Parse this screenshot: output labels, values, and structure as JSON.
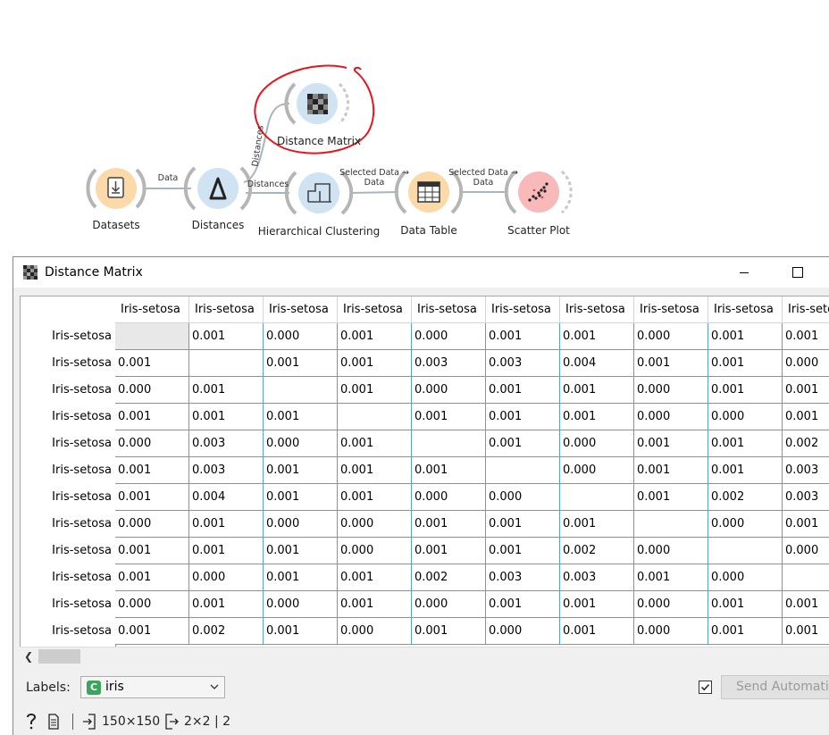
{
  "workflow": {
    "nodes": {
      "datasets": "Datasets",
      "distances": "Distances",
      "distance_matrix": "Distance Matrix",
      "hierarchical_clustering": "Hierarchical Clustering",
      "data_table": "Data Table",
      "scatter_plot": "Scatter Plot"
    },
    "links": {
      "datasets_to_distances": "Data",
      "distances_to_matrix": "Distances",
      "distances_to_clustering": "Distances",
      "clustering_to_table_top": "Selected Data →",
      "clustering_to_table_bottom": "Data",
      "table_to_scatter_top": "Selected Data →",
      "table_to_scatter_bottom": "Data"
    },
    "colors": {
      "orange_node": "#fcd9a8",
      "blue_node": "#cfe3f3",
      "red_node": "#f7b9b9",
      "annotation": "#e8141c"
    }
  },
  "window": {
    "title": "Distance Matrix",
    "title_icon": "distance-matrix-icon",
    "controls": [
      "minimize-icon",
      "maximize-icon"
    ]
  },
  "matrix": {
    "columns": [
      "Iris-setosa",
      "Iris-setosa",
      "Iris-setosa",
      "Iris-setosa",
      "Iris-setosa",
      "Iris-setosa",
      "Iris-setosa",
      "Iris-setosa",
      "Iris-setosa",
      "Iris-setosa"
    ],
    "rows": [
      {
        "label": "Iris-setosa",
        "cells": [
          "",
          "0.001",
          "0.000",
          "0.001",
          "0.000",
          "0.001",
          "0.001",
          "0.000",
          "0.001",
          "0.001"
        ]
      },
      {
        "label": "Iris-setosa",
        "cells": [
          "0.001",
          "",
          "0.001",
          "0.001",
          "0.003",
          "0.003",
          "0.004",
          "0.001",
          "0.001",
          "0.000"
        ]
      },
      {
        "label": "Iris-setosa",
        "cells": [
          "0.000",
          "0.001",
          "",
          "0.001",
          "0.000",
          "0.001",
          "0.001",
          "0.000",
          "0.001",
          "0.001"
        ]
      },
      {
        "label": "Iris-setosa",
        "cells": [
          "0.001",
          "0.001",
          "0.001",
          "",
          "0.001",
          "0.001",
          "0.001",
          "0.000",
          "0.000",
          "0.001"
        ]
      },
      {
        "label": "Iris-setosa",
        "cells": [
          "0.000",
          "0.003",
          "0.000",
          "0.001",
          "",
          "0.001",
          "0.000",
          "0.001",
          "0.001",
          "0.002"
        ]
      },
      {
        "label": "Iris-setosa",
        "cells": [
          "0.001",
          "0.003",
          "0.001",
          "0.001",
          "0.001",
          "",
          "0.000",
          "0.001",
          "0.001",
          "0.003"
        ]
      },
      {
        "label": "Iris-setosa",
        "cells": [
          "0.001",
          "0.004",
          "0.001",
          "0.001",
          "0.000",
          "0.000",
          "",
          "0.001",
          "0.002",
          "0.003"
        ]
      },
      {
        "label": "Iris-setosa",
        "cells": [
          "0.000",
          "0.001",
          "0.000",
          "0.000",
          "0.001",
          "0.001",
          "0.001",
          "",
          "0.000",
          "0.001"
        ]
      },
      {
        "label": "Iris-setosa",
        "cells": [
          "0.001",
          "0.001",
          "0.001",
          "0.000",
          "0.001",
          "0.001",
          "0.002",
          "0.000",
          "",
          "0.000"
        ]
      },
      {
        "label": "Iris-setosa",
        "cells": [
          "0.001",
          "0.000",
          "0.001",
          "0.001",
          "0.002",
          "0.003",
          "0.003",
          "0.001",
          "0.000",
          ""
        ]
      },
      {
        "label": "Iris-setosa",
        "cells": [
          "0.000",
          "0.001",
          "0.000",
          "0.001",
          "0.000",
          "0.001",
          "0.001",
          "0.000",
          "0.001",
          "0.001"
        ]
      },
      {
        "label": "Iris-setosa",
        "cells": [
          "0.001",
          "0.002",
          "0.001",
          "0.000",
          "0.001",
          "0.000",
          "0.001",
          "0.000",
          "0.001",
          "0.001"
        ]
      }
    ],
    "selected_cell": {
      "row": 0,
      "col": 0
    }
  },
  "controls": {
    "labels_caption": "Labels:",
    "labels_value": "iris",
    "labels_value_icon": "C",
    "send_automatically_checked": true,
    "send_button": "Send Automatically"
  },
  "status": {
    "help_icon": "question-icon",
    "report_icon": "document-icon",
    "input_icon": "input-icon",
    "input_size": "150×150",
    "output_icon": "output-icon",
    "output_size": "2×2 | 2"
  }
}
